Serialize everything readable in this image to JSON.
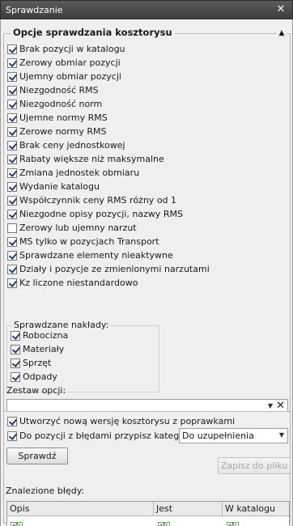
{
  "window": {
    "title": "Sprawdzanie",
    "close_glyph": "✕"
  },
  "options_group": {
    "legend": "Opcje sprawdzania kosztorysu",
    "collapse_glyph": "▲",
    "items": [
      {
        "label": "Brak pozycji w katalogu",
        "checked": true
      },
      {
        "label": "Zerowy obmiar pozycji",
        "checked": true
      },
      {
        "label": "Ujemny obmiar pozycji",
        "checked": true
      },
      {
        "label": "Niezgodność RMS",
        "checked": true
      },
      {
        "label": "Niezgodność norm",
        "checked": true
      },
      {
        "label": "Ujemne normy RMS",
        "checked": true
      },
      {
        "label": "Zerowe normy RMS",
        "checked": true
      },
      {
        "label": "Brak ceny jednostkowej",
        "checked": true
      },
      {
        "label": "Rabaty większe niż maksymalne",
        "checked": true
      },
      {
        "label": "Zmiana jednostek obmiaru",
        "checked": true
      },
      {
        "label": "Wydanie katalogu",
        "checked": true
      },
      {
        "label": "Współczynnik ceny RMS różny od 1",
        "checked": true
      },
      {
        "label": "Niezgodne opisy pozycji, nazwy RMS",
        "checked": true
      },
      {
        "label": "Zerowy lub ujemny narzut",
        "checked": false
      },
      {
        "label": "MS tylko w pozycjach Transport",
        "checked": true
      },
      {
        "label": "Sprawdzane elementy nieaktywne",
        "checked": true
      },
      {
        "label": "Działy i pozycje ze zmienionymi narzutami",
        "checked": true
      },
      {
        "label": "Kz liczone niestandardowo",
        "checked": true
      }
    ],
    "naklady": {
      "legend": "Sprawdzane nakłady:",
      "items": [
        {
          "label": "Robocizna",
          "checked": true
        },
        {
          "label": "Materiały",
          "checked": true
        },
        {
          "label": "Sprzęt",
          "checked": true
        },
        {
          "label": "Odpady",
          "checked": true
        }
      ]
    },
    "zestaw_label": "Zestaw opcji:",
    "zestaw_value": ""
  },
  "bottom": {
    "create_version_label": "Utworzyć nową wersję kosztorysu z poprawkami",
    "create_version_checked": true,
    "assign_category_label": "Do pozycji z błędami przypisz kategorię:",
    "assign_category_checked": true,
    "category_value": "Do uzupełnienia",
    "check_button": "Sprawdź",
    "save_button": "Zapisz do pliku",
    "errors_label": "Znalezione błędy:",
    "columns": [
      "Opis",
      "Jest",
      "W katalogu"
    ]
  }
}
